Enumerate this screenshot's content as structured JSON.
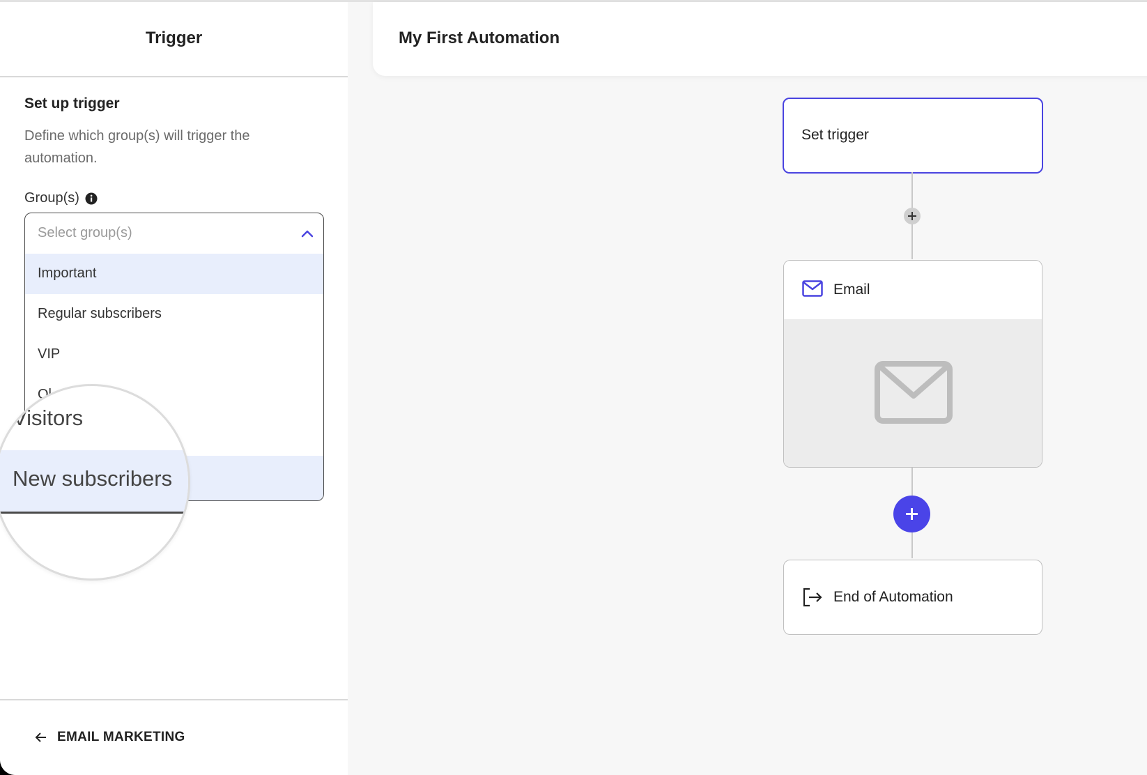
{
  "sidebar": {
    "title": "Trigger",
    "section_title": "Set up trigger",
    "section_desc": "Define which group(s) will trigger the automation.",
    "group_label": "Group(s)",
    "select": {
      "placeholder": "Select group(s)",
      "options": [
        "Important",
        "Regular subscribers",
        "VIP",
        "Ol"
      ]
    },
    "magnifier": {
      "visitors": "Visitors",
      "new_subscribers": "New subscribers"
    },
    "back_label": "EMAIL MARKETING"
  },
  "header": {
    "title": "My First Automation"
  },
  "flow": {
    "trigger_label": "Set trigger",
    "email_label": "Email",
    "end_label": "End of Automation"
  },
  "colors": {
    "accent": "#4a44e8",
    "highlight": "#e8eefc"
  }
}
